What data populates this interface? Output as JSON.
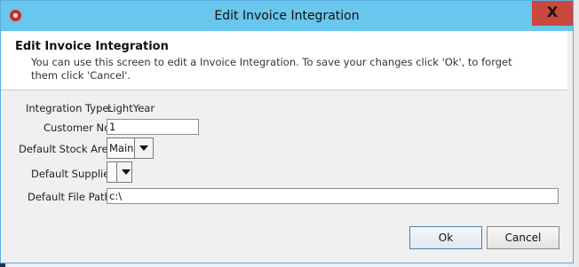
{
  "window": {
    "title": "Edit Invoice Integration",
    "close_label": "X"
  },
  "header": {
    "title": "Edit Invoice Integration",
    "description": "You can use this screen to edit a Invoice Integration. To save your changes click 'Ok', to forget them click 'Cancel'."
  },
  "form": {
    "integration_type_label": "Integration Type:",
    "integration_type_value": "LightYear",
    "customer_no_label": "Customer No",
    "customer_no_value": "1",
    "default_stock_area_label": "Default Stock Area",
    "default_stock_area_value": "Main",
    "default_supplier_label": "Default Supplier",
    "default_supplier_value": "",
    "default_file_path_label": "Default File Path",
    "default_file_path_value": "c:\\"
  },
  "buttons": {
    "ok": "Ok",
    "cancel": "Cancel"
  }
}
